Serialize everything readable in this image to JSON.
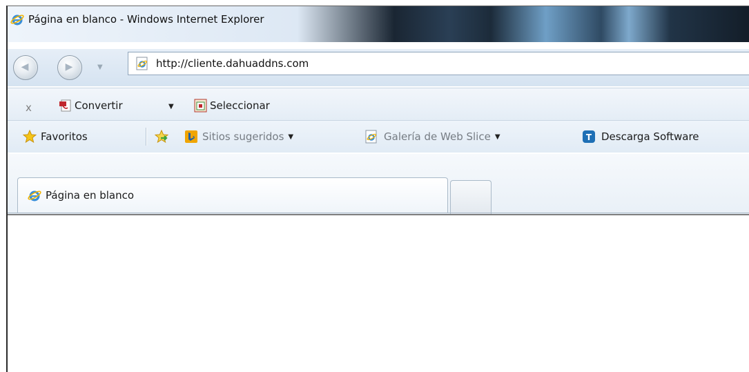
{
  "window": {
    "title": "Página en blanco - Windows Internet Explorer",
    "app_icon": "ie-logo-icon"
  },
  "navigation": {
    "back_icon": "back-arrow-icon",
    "forward_icon": "forward-arrow-icon",
    "recent_pages_icon": "chevron-down-icon",
    "address": {
      "url": "http://cliente.dahuaddns.com",
      "page_icon": "ie-page-icon"
    }
  },
  "command_bar": {
    "close_label": "x",
    "convert": {
      "label": "Convertir",
      "icon": "pdf-convert-icon",
      "dropdown_icon": "chevron-down-icon"
    },
    "select": {
      "label": "Seleccionar",
      "icon": "select-pdf-icon"
    }
  },
  "favorites_bar": {
    "favorites": {
      "label": "Favoritos",
      "icon": "star-icon"
    },
    "add_favorite_icon": "add-to-favorites-icon",
    "items": [
      {
        "label": "Sitios sugeridos",
        "icon": "bing-icon",
        "has_dropdown": true
      },
      {
        "label": "Galería de Web Slice",
        "icon": "ie-page-icon",
        "has_dropdown": true
      },
      {
        "label": "Descarga Software",
        "icon": "t-badge-icon",
        "has_dropdown": false
      }
    ]
  },
  "tabs": [
    {
      "label": "Página en blanco",
      "active": true,
      "icon": "ie-logo-icon"
    }
  ],
  "colors": {
    "accent": "#1e6fb5",
    "bing_orange": "#f0a500"
  }
}
